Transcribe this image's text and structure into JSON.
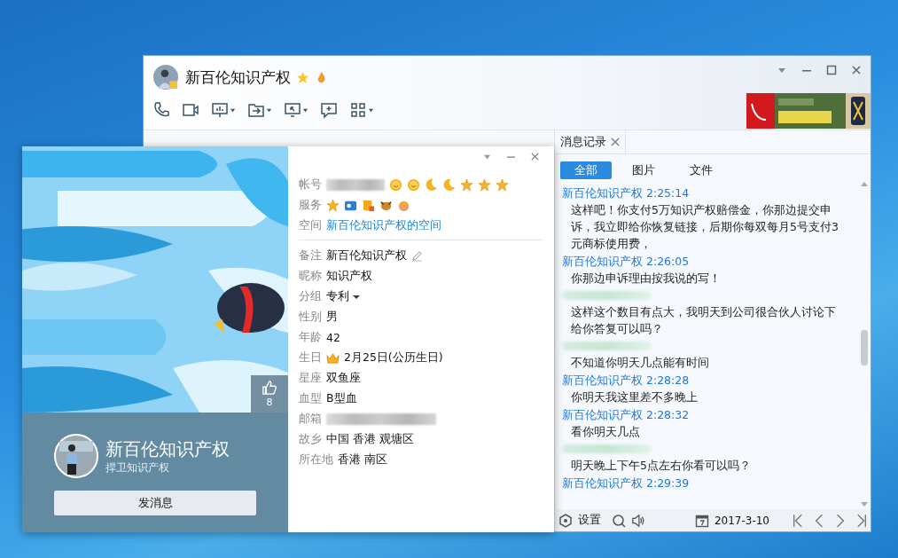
{
  "chat_window": {
    "title": "新百伦知识产权",
    "toolbar": [
      {
        "kind": "phone",
        "dropdown": false
      },
      {
        "kind": "video",
        "dropdown": false
      },
      {
        "kind": "present",
        "dropdown": true
      },
      {
        "kind": "file",
        "dropdown": true
      },
      {
        "kind": "remote",
        "dropdown": true
      },
      {
        "kind": "note",
        "dropdown": false
      },
      {
        "kind": "apps",
        "dropdown": true
      }
    ]
  },
  "history": {
    "tab": "消息记录",
    "filters": [
      {
        "label": "全部",
        "selected": true
      },
      {
        "label": "图片",
        "selected": false
      },
      {
        "label": "文件",
        "selected": false
      }
    ],
    "messages": [
      {
        "kind": "named",
        "sender": "新百伦知识产权",
        "time": "2:25:14",
        "text": "这样吧！你支付5万知识产权赔偿金，你那边提交申诉，我立即给你恢复链接，后期你每双每月5号支付3元商标使用费，"
      },
      {
        "kind": "named",
        "sender": "新百伦知识产权",
        "time": "2:26:05",
        "text": "你那边申诉理由按我说的写！"
      },
      {
        "kind": "blurred",
        "text": "这样这个数目有点大，我明天到公司很合伙人讨论下给你答复可以吗？"
      },
      {
        "kind": "blurred",
        "text": "不知道你明天几点能有时间"
      },
      {
        "kind": "named",
        "sender": "新百伦知识产权",
        "time": "2:28:28",
        "text": "你明天我这里差不多晚上"
      },
      {
        "kind": "named",
        "sender": "新百伦知识产权",
        "time": "2:28:32",
        "text": "看你明天几点"
      },
      {
        "kind": "blurred",
        "text": "明天晚上下午5点左右你看可以吗？"
      },
      {
        "kind": "named",
        "sender": "新百伦知识产权",
        "time": "2:29:39"
      }
    ],
    "footer": {
      "settings": "设置",
      "date": "2017-3-10"
    }
  },
  "profile": {
    "name": "新百伦知识产权",
    "signature": "捍卫知识产权",
    "send_button": "发消息",
    "likes": "8",
    "sections": [
      {
        "fields": [
          {
            "label": "帐号",
            "kind": "account",
            "badges": [
              {
                "kind": "sun"
              },
              {
                "kind": "sun"
              },
              {
                "kind": "moon"
              },
              {
                "kind": "moon"
              },
              {
                "kind": "star"
              },
              {
                "kind": "star"
              },
              {
                "kind": "star"
              }
            ]
          },
          {
            "label": "服务",
            "kind": "services",
            "badges": [
              {
                "kind": "star"
              },
              {
                "kind": "card"
              },
              {
                "kind": "shield"
              },
              {
                "kind": "dog"
              },
              {
                "kind": "monkey"
              }
            ]
          },
          {
            "label": "空间",
            "kind": "link",
            "value": "新百伦知识产权的空间"
          }
        ]
      },
      {
        "fields": [
          {
            "label": "备注",
            "kind": "editable",
            "value": "新百伦知识产权"
          },
          {
            "label": "昵称",
            "kind": "text",
            "value": "知识产权"
          },
          {
            "label": "分组",
            "kind": "dropdown",
            "value": "专利"
          },
          {
            "label": "性别",
            "kind": "text",
            "value": "男"
          },
          {
            "label": "年龄",
            "kind": "text",
            "value": "42"
          },
          {
            "label": "生日",
            "kind": "birthday",
            "value": "2月25日(公历生日)"
          },
          {
            "label": "星座",
            "kind": "text",
            "value": "双鱼座"
          },
          {
            "label": "血型",
            "kind": "text",
            "value": "B型血"
          },
          {
            "label": "邮箱",
            "kind": "blurred"
          },
          {
            "label": "故乡",
            "kind": "text",
            "value": "中国 香港 观塘区"
          },
          {
            "label": "所在地",
            "kind": "text",
            "value": "香港 南区"
          }
        ]
      }
    ]
  }
}
